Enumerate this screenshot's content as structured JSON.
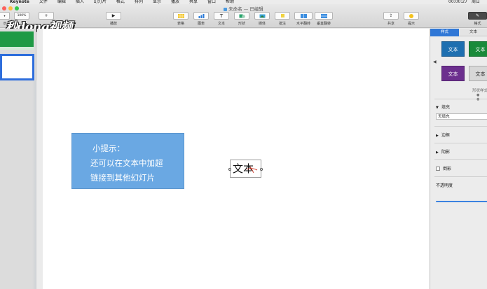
{
  "menubar": {
    "app": "Keynote",
    "items": [
      "文件",
      "编辑",
      "插入",
      "幻灯片",
      "格式",
      "排列",
      "显示",
      "播放",
      "共享",
      "窗口",
      "帮助"
    ],
    "clock": "00:00:27",
    "user": "周日"
  },
  "window": {
    "title": "未命名 — 已编辑"
  },
  "toolbar": {
    "view_value": "示",
    "zoom_value": "100%",
    "add_slide_label": "+",
    "play_label": "播放",
    "table_label": "表格",
    "chart_label": "图表",
    "text_label": "文本",
    "shape_label": "形状",
    "media_label": "媒体",
    "comment_label": "批注",
    "hflip_label": "水平翻转",
    "vflip_label": "垂直翻转",
    "share_label": "共享",
    "tips_label": "提示",
    "format_label": "格式",
    "text_glyph": "T",
    "play_glyph": "▶"
  },
  "slide": {
    "tip_lines": [
      "小提示：",
      "还可以在文本中加超",
      "链接到其他幻灯片"
    ],
    "textbox_text": "文本"
  },
  "watermark": {
    "logo_text": "秒dong视频"
  },
  "inspector": {
    "tabs": [
      "样式",
      "文本"
    ],
    "styles": [
      {
        "label": "文本",
        "color": "#1e6fb0"
      },
      {
        "label": "文本",
        "color": "#1a8a3a"
      },
      {
        "label": "文本",
        "color": "#6c2f8e"
      },
      {
        "label": "文本",
        "color": "#d8d8d8"
      }
    ],
    "style_caption": "形状样式",
    "sections": {
      "fill": "填充",
      "fill_value": "无填充",
      "border": "边框",
      "shadow": "阴影",
      "reflection": "倒影",
      "opacity": "不透明度"
    }
  },
  "colors": {
    "accent": "#2f77d6",
    "tip_box": "#6aa8e3",
    "thumbnail_green": "#1e9a45"
  }
}
